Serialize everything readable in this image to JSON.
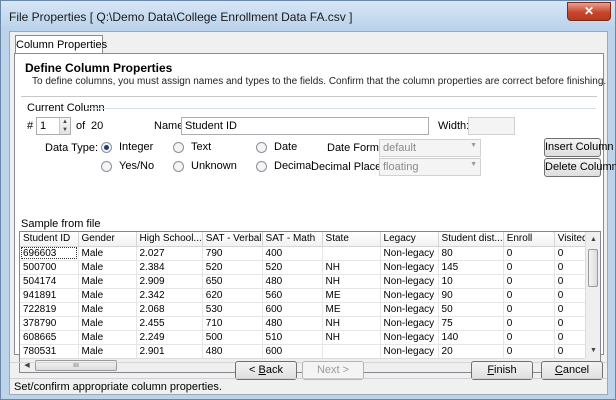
{
  "window": {
    "title": "File Properties [ Q:\\Demo Data\\College Enrollment Data FA.csv ]"
  },
  "tab": {
    "label": "Column Properties"
  },
  "header": {
    "heading": "Define Column Properties",
    "subheading": "To define columns, you must assign names and types to the fields.  Confirm that the column properties are correct before finishing."
  },
  "current_column": {
    "group_label": "Current Column",
    "hash_label": "#",
    "index_value": "1",
    "of_label": "of",
    "total": "20",
    "name_label": "Name:",
    "name_value": "Student ID",
    "width_label": "Width:",
    "width_value": "",
    "data_type_label": "Data Type:",
    "types": [
      {
        "label": "Integer",
        "checked": true
      },
      {
        "label": "Text",
        "checked": false
      },
      {
        "label": "Date",
        "checked": false
      },
      {
        "label": "Yes/No",
        "checked": false
      },
      {
        "label": "Unknown",
        "checked": false
      },
      {
        "label": "Decimal",
        "checked": false
      }
    ],
    "date_format_label": "Date Format:",
    "date_format_value": "default",
    "decimal_places_label": "Decimal Places:",
    "decimal_places_value": "floating",
    "insert_button": "Insert Column",
    "delete_button": "Delete Column"
  },
  "sample": {
    "label": "Sample from file",
    "columns": [
      "Student ID",
      "Gender",
      "High School...",
      "SAT - Verbal",
      "SAT - Math",
      "State",
      "Legacy",
      "Student dist...",
      "Enroll",
      "Visited"
    ],
    "rows": [
      [
        "696603",
        "Male",
        "2.027",
        "790",
        "400",
        "",
        "Non-legacy",
        "80",
        "0",
        "0"
      ],
      [
        "500700",
        "Male",
        "2.384",
        "520",
        "520",
        "NH",
        "Non-legacy",
        "145",
        "0",
        "0"
      ],
      [
        "504174",
        "Male",
        "2.909",
        "650",
        "480",
        "NH",
        "Non-legacy",
        "10",
        "0",
        "0"
      ],
      [
        "941891",
        "Male",
        "2.342",
        "620",
        "560",
        "ME",
        "Non-legacy",
        "90",
        "0",
        "0"
      ],
      [
        "722819",
        "Male",
        "2.068",
        "530",
        "600",
        "ME",
        "Non-legacy",
        "50",
        "0",
        "0"
      ],
      [
        "378790",
        "Male",
        "2.455",
        "710",
        "480",
        "NH",
        "Non-legacy",
        "75",
        "0",
        "0"
      ],
      [
        "608665",
        "Male",
        "2.249",
        "500",
        "510",
        "NH",
        "Non-legacy",
        "140",
        "0",
        "0"
      ],
      [
        "780531",
        "Male",
        "2.901",
        "480",
        "600",
        "",
        "Non-legacy",
        "20",
        "0",
        "0"
      ]
    ],
    "hscroll_grip": "III"
  },
  "footer": {
    "back_mnemonic": "B",
    "back_rest": "ack",
    "back_prefix": "< ",
    "next": "Next >",
    "finish_mnemonic": "F",
    "finish_rest": "inish",
    "cancel_mnemonic": "C",
    "cancel_rest": "ancel"
  },
  "status": {
    "text": "Set/confirm appropriate column properties."
  },
  "colors": {
    "title_bg": "#bcd3ea",
    "close_red": "#c8452c",
    "client_bg": "#f0f0f0"
  }
}
